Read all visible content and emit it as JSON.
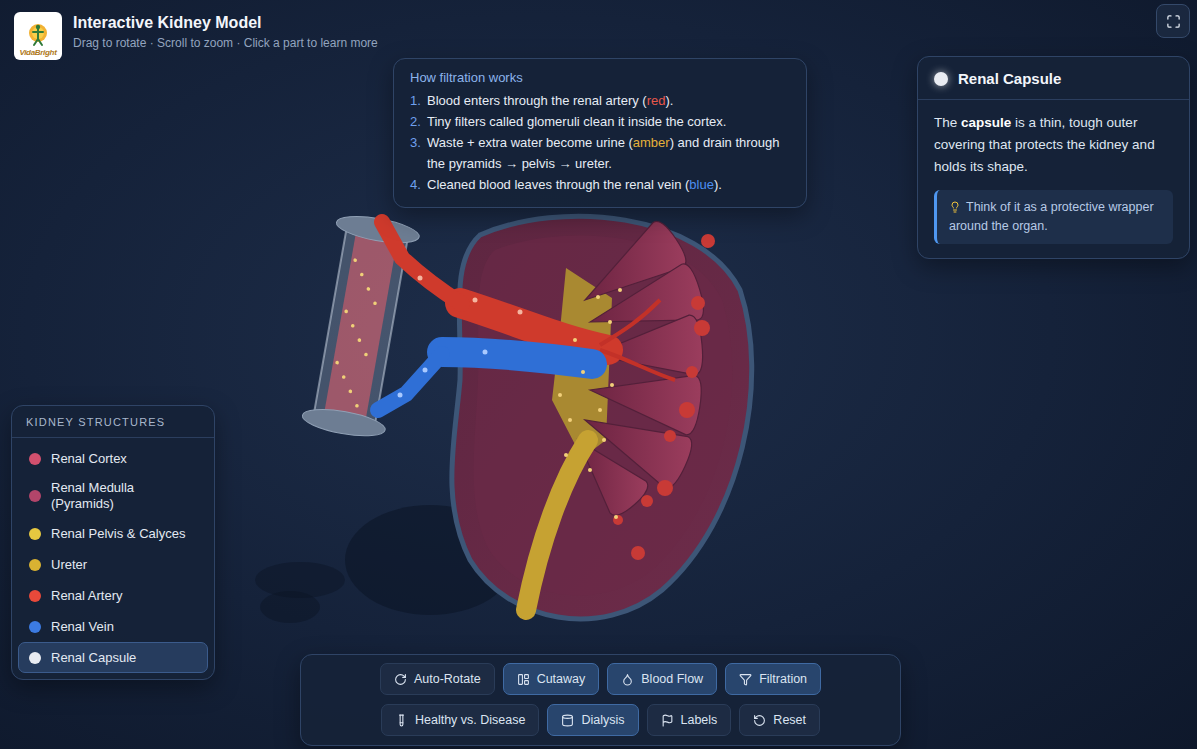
{
  "header": {
    "logo_text": "VidaBright",
    "title": "Interactive Kidney Model",
    "subtitle": "Drag to rotate · Scroll to zoom · Click a part to learn more"
  },
  "filtration": {
    "title": "How filtration works",
    "steps": [
      {
        "number": "1.",
        "parts": [
          {
            "text": "Blood enters through the renal artery (",
            "color": null
          },
          {
            "text": "red",
            "color": "#e8574b"
          },
          {
            "text": ").",
            "color": null
          }
        ]
      },
      {
        "number": "2.",
        "parts": [
          {
            "text": "Tiny filters called glomeruli clean it inside the cortex.",
            "color": null
          }
        ]
      },
      {
        "number": "3.",
        "parts": [
          {
            "text": "Waste + extra water become urine (",
            "color": null
          },
          {
            "text": "amber",
            "color": "#e5b13a"
          },
          {
            "text": ") and drain through the pyramids → pelvis → ureter.",
            "color": null
          }
        ]
      },
      {
        "number": "4.",
        "parts": [
          {
            "text": "Cleaned blood leaves through the renal vein (",
            "color": null
          },
          {
            "text": "blue",
            "color": "#4d8ff0"
          },
          {
            "text": ").",
            "color": null
          }
        ]
      }
    ]
  },
  "info": {
    "title": "Renal Capsule",
    "color": "#e9ecf2",
    "body": [
      {
        "text": "The ",
        "bold": false
      },
      {
        "text": "capsule",
        "bold": true
      },
      {
        "text": " is a thin, tough outer covering that protects the kidney and holds its shape.",
        "bold": false
      }
    ],
    "tip": "Think of it as a protective wrapper around the organ."
  },
  "legend": {
    "title": "KIDNEY STRUCTURES",
    "items": [
      {
        "name": "Renal Cortex",
        "color": "#d2506e",
        "selected": false
      },
      {
        "name": "Renal Medulla (Pyramids)",
        "color": "#b2456a",
        "selected": false
      },
      {
        "name": "Renal Pelvis & Calyces",
        "color": "#e6c840",
        "selected": false
      },
      {
        "name": "Ureter",
        "color": "#d9b232",
        "selected": false
      },
      {
        "name": "Renal Artery",
        "color": "#e8493a",
        "selected": false
      },
      {
        "name": "Renal Vein",
        "color": "#3c7be2",
        "selected": false
      },
      {
        "name": "Renal Capsule",
        "color": "#e9ecf2",
        "selected": true
      }
    ]
  },
  "toolbar": {
    "rows": [
      [
        {
          "label": "Auto-Rotate",
          "selected": false
        },
        {
          "label": "Cutaway",
          "selected": true
        },
        {
          "label": "Blood Flow",
          "selected": true
        },
        {
          "label": "Filtration",
          "selected": true
        }
      ],
      [
        {
          "label": "Healthy vs. Disease",
          "selected": false
        },
        {
          "label": "Dialysis",
          "selected": true
        },
        {
          "label": "Labels",
          "selected": false
        },
        {
          "label": "Reset",
          "selected": false
        }
      ]
    ]
  }
}
